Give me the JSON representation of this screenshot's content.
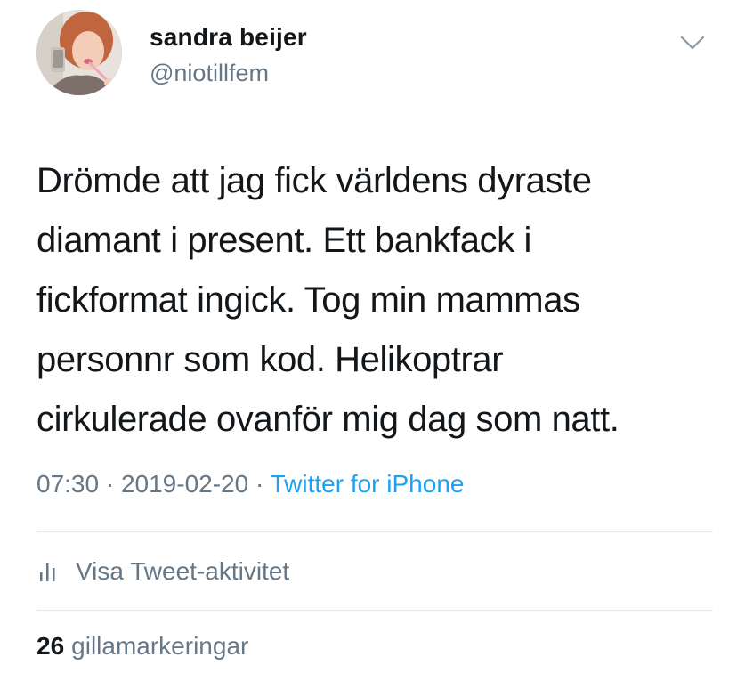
{
  "user": {
    "display_name": "sandra beijer",
    "handle": "@niotillfem"
  },
  "tweet": {
    "text": "Drömde att jag fick världens dyraste diamant i present. Ett bankfack i fickformat ingick. Tog min mammas personnr som kod. Helikoptrar cirkulerade ovanför mig dag som natt.",
    "lines": [
      "Drömde att jag fick världens dyraste",
      "diamant i present. Ett bankfack i",
      "fickformat ingick. Tog min mammas",
      "personnr som kod. Helikoptrar",
      "cirkulerade ovanför mig dag som natt."
    ],
    "time": "07:30",
    "date": "2019-02-20",
    "separator": "·",
    "source": "Twitter for iPhone"
  },
  "actions": {
    "activity_label": "Visa Tweet-aktivitet"
  },
  "stats": {
    "like_count": "26",
    "like_label": "gillamarkeringar"
  },
  "icons": {
    "caret": "chevron-down-icon",
    "activity": "bar-chart-icon"
  },
  "colors": {
    "text_primary": "#14171a",
    "text_secondary": "#657786",
    "link": "#1da1f2",
    "divider": "#e1e8ed"
  }
}
